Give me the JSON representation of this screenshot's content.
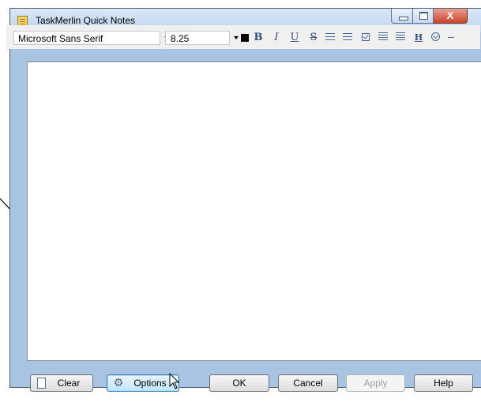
{
  "window": {
    "title": "TaskMerlin Quick Notes",
    "icon": "notepad-icon",
    "close_glyph": "X"
  },
  "toolbar": {
    "font_family": "Microsoft Sans Serif",
    "font_size": "8.25",
    "bold": "B",
    "italic": "I",
    "underline": "U",
    "strikethrough": "S",
    "hyperlink": "H",
    "icons": [
      "color-swatch-icon",
      "bold-icon",
      "italic-icon",
      "underline-icon",
      "strikethrough-icon",
      "bulleted-list-icon",
      "numbered-list-icon",
      "checkbox-icon",
      "decrease-indent-icon",
      "increase-indent-icon",
      "hyperlink-icon",
      "more-options-icon"
    ]
  },
  "editor": {
    "content": ""
  },
  "buttons": {
    "clear": "Clear",
    "options": "Options",
    "ok": "OK",
    "cancel": "Cancel",
    "apply": "Apply",
    "help": "Help"
  },
  "colors": {
    "window_frame": "#a9c4e2",
    "close_button": "#c8442c",
    "toolbar_bg": "#f0f0f0"
  }
}
